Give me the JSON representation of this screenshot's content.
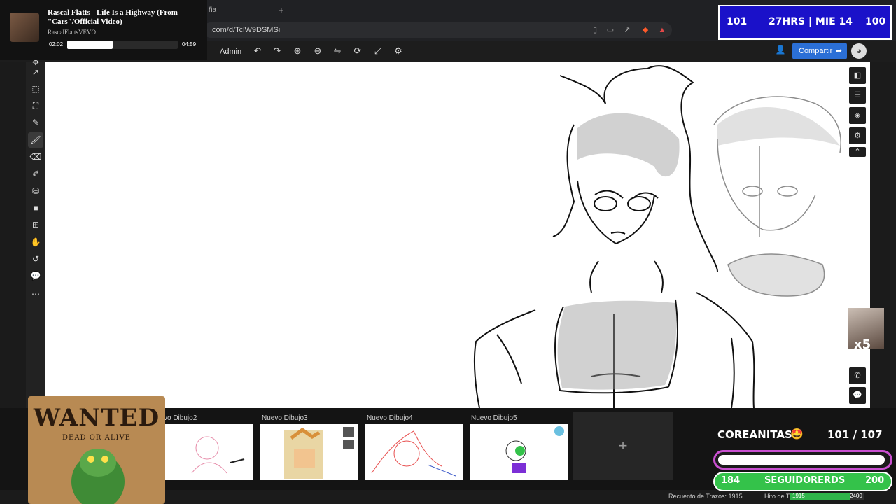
{
  "browser": {
    "tab_partial": "ña",
    "new_tab": "+",
    "url": ".com/d/TclW9DSMSi"
  },
  "toolbar": {
    "admin_label": "Admin",
    "share_label": "Compartir",
    "icons": [
      "undo-icon",
      "redo-icon",
      "zoom-in-icon",
      "zoom-out-icon",
      "flip-icon",
      "rotate-icon",
      "fullscreen-icon",
      "settings-icon"
    ]
  },
  "music": {
    "title": "Rascal Flatts - Life Is a Highway (From \"Cars\"/Official Video)",
    "artist": "RascalFlattsVEVO",
    "current_time": "02:02",
    "total_time": "04:59",
    "progress": 0.41
  },
  "stream": {
    "left_count": "101",
    "time_label": "27HRS | MIE 14",
    "right_count": "100"
  },
  "thumbnails": [
    {
      "label": "vo Dibujo2"
    },
    {
      "label": "Nuevo Dibujo3"
    },
    {
      "label": "Nuevo Dibujo4"
    },
    {
      "label": "Nuevo Dibujo5"
    }
  ],
  "new_drawing": "+",
  "status": {
    "stroke_count": "Recuento de Trazos: 1915",
    "milestone_label": "Hito de Trazos:",
    "progress_min": "1915",
    "progress_max": "2400",
    "progress_fraction": 0.8
  },
  "wanted": {
    "title": "WANTED",
    "subtitle": "DEAD OR ALIVE"
  },
  "goal": {
    "label": "COREANITAS",
    "count": "101  / 107",
    "current": "184",
    "name": "SEGUIDORERDS",
    "target": "200"
  },
  "cam_badge": "x5",
  "colors": {
    "share_blue": "#2b6fd6",
    "stream_box": "#1a11c9",
    "goal_green": "#34c24a",
    "goal_border": "#c94fd0"
  }
}
